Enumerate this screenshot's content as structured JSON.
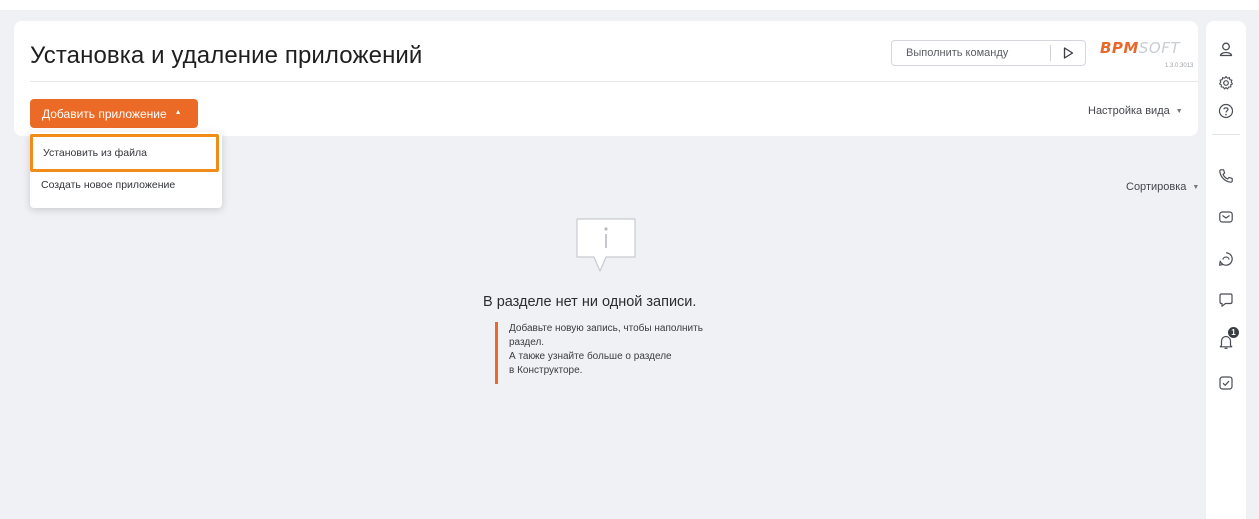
{
  "header": {
    "title": "Установка и удаление приложений",
    "command": {
      "placeholder": "Выполнить команду"
    },
    "logo": {
      "part1": "BPM",
      "part2": "SOFT"
    },
    "version": "1.3.0.3013"
  },
  "toolbar": {
    "add_app_label": "Добавить приложение",
    "view_settings_label": "Настройка вида",
    "sorting_label": "Сортировка"
  },
  "dropdown": {
    "items": [
      {
        "label": "Установить из файла",
        "highlighted": true
      },
      {
        "label": "Создать новое приложение",
        "highlighted": false
      }
    ]
  },
  "empty_state": {
    "title": "В разделе нет ни одной записи.",
    "lines": [
      "Добавьте новую запись, чтобы наполнить",
      "раздел.",
      "А также узнайте больше о разделе",
      "в Конструкторе."
    ]
  },
  "right_panel": {
    "icons": [
      "user-icon",
      "gear-icon",
      "help-icon",
      "phone-icon",
      "mail-icon",
      "chat-icon",
      "message-icon",
      "bell-icon",
      "checkbox-icon"
    ],
    "notifications_count": "1"
  },
  "colors": {
    "accent": "#ea6a26",
    "highlight_frame": "#f08c18",
    "background": "#f0f1f4"
  }
}
